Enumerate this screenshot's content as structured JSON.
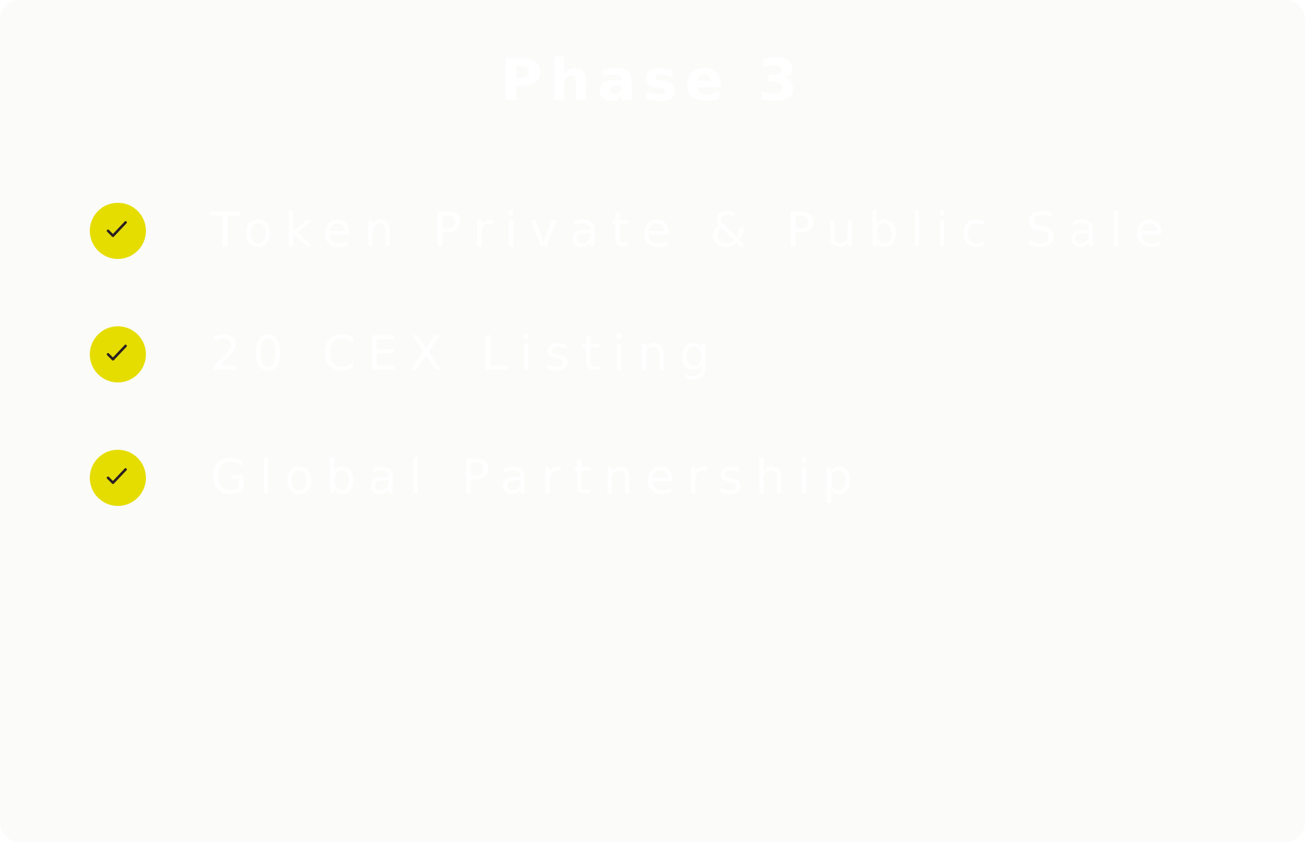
{
  "card": {
    "title": "Phase 3",
    "milestones": [
      {
        "label": "Token Private & Public Sale",
        "completed": true,
        "icon": "check-icon"
      },
      {
        "label": "20 CEX Listing",
        "completed": true,
        "icon": "check-icon"
      },
      {
        "label": "Global Partnership",
        "completed": true,
        "icon": "check-icon"
      }
    ]
  },
  "colors": {
    "card_background": "#fbfbfa",
    "text": "#ffffff",
    "check_badge": "#e5dd00",
    "check_mark": "#2a1f22"
  }
}
